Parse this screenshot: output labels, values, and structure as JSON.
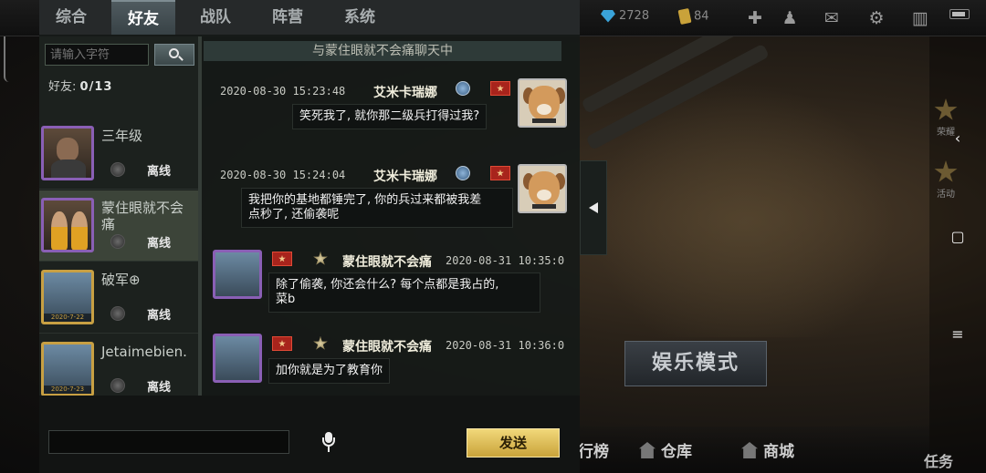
{
  "topbar": {
    "tabs": [
      {
        "label": "综合"
      },
      {
        "label": "好友",
        "active": true
      },
      {
        "label": "战队"
      },
      {
        "label": "阵营"
      },
      {
        "label": "系统"
      }
    ],
    "gems": "2728",
    "cards": "84"
  },
  "friends": {
    "search_placeholder": "请输入字符",
    "count_label": "好友:",
    "count_value": "0/13",
    "items": [
      {
        "name": "三年级",
        "status": "离线"
      },
      {
        "name": "蒙住眼就不会痛",
        "status": "离线",
        "selected": true
      },
      {
        "name": "破军⊕",
        "status": "离线",
        "date": "2020-7-22"
      },
      {
        "name": "Jetaimebien.",
        "status": "离线",
        "date": "2020-7-23"
      }
    ]
  },
  "chat": {
    "title": "与蒙住眼就不会痛聊天中",
    "messages": [
      {
        "time": "2020-08-30 15:23:48",
        "name": "艾米卡瑞娜",
        "text": "笑死我了, 就你那二级兵打得过我?",
        "side": "right"
      },
      {
        "time": "2020-08-30 15:24:04",
        "name": "艾米卡瑞娜",
        "text_line1": "我把你的基地都锤完了, 你的兵过来都被我差",
        "text_line2": "点秒了, 还偷袭呢",
        "side": "right"
      },
      {
        "time": "2020-08-31 10:35:0",
        "name": "蒙住眼就不会痛",
        "text_line1": "除了偷袭, 你还会什么? 每个点都是我占的,",
        "text_line2": "菜b",
        "side": "left"
      },
      {
        "time": "2020-08-31 10:36:0",
        "name": "蒙住眼就不会痛",
        "text": "加你就是为了教育你",
        "side": "left"
      }
    ],
    "send_label": "发送",
    "input_value": ""
  },
  "background": {
    "mode_button": "娱乐模式",
    "bottom_items": [
      "排行榜",
      "仓库",
      "商城"
    ],
    "mission_label": "任务",
    "rail_items": [
      "荣耀",
      "活动"
    ]
  },
  "colors": {
    "accent_gold": "#c9a33a",
    "avatar_frame_purple": "#8a5fb5",
    "offline_text": "#e6e6e6"
  },
  "icons": [
    "search-icon",
    "mic-icon",
    "gem-icon",
    "card-icon",
    "add-icon",
    "friends-icon",
    "mail-icon",
    "gear-icon",
    "book-icon",
    "battery-icon",
    "collapse-arrow-icon",
    "rank-badge-icon",
    "camp-badge-icon"
  ]
}
